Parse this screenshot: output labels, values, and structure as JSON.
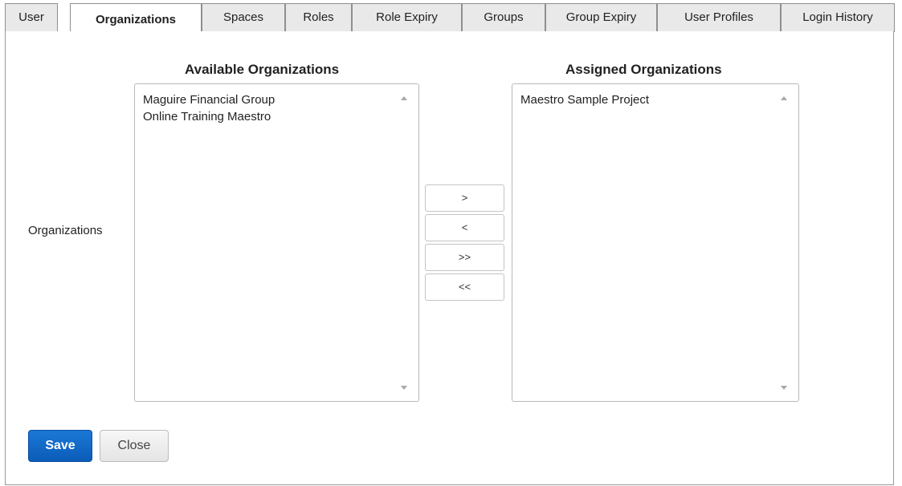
{
  "tabs": [
    {
      "label": "User",
      "active": false
    },
    {
      "label": "Organizations",
      "active": true
    },
    {
      "label": "Spaces",
      "active": false
    },
    {
      "label": "Roles",
      "active": false
    },
    {
      "label": "Role Expiry",
      "active": false
    },
    {
      "label": "Groups",
      "active": false
    },
    {
      "label": "Group Expiry",
      "active": false
    },
    {
      "label": "User Profiles",
      "active": false
    },
    {
      "label": "Login History",
      "active": false
    }
  ],
  "organizations": {
    "field_label": "Organizations",
    "available": {
      "heading": "Available Organizations",
      "items": [
        "Maguire Financial Group",
        "Online Training Maestro"
      ]
    },
    "assigned": {
      "heading": "Assigned Organizations",
      "items": [
        "Maestro Sample Project"
      ]
    },
    "move_buttons": {
      "add": ">",
      "remove": "<",
      "add_all": ">>",
      "remove_all": "<<"
    }
  },
  "actions": {
    "save_label": "Save",
    "close_label": "Close"
  },
  "colors": {
    "primary": "#0b5cb8",
    "tab_inactive": "#e9e9e9",
    "border": "#9a9a9a"
  }
}
